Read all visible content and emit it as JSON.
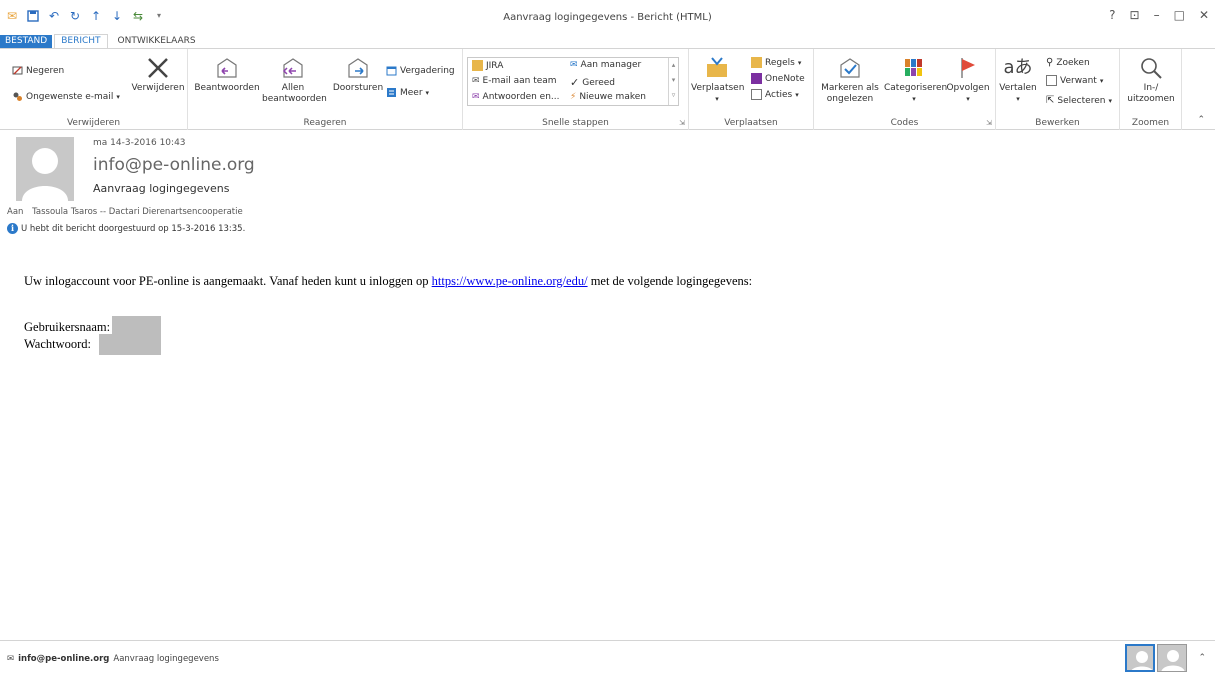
{
  "window": {
    "title": "Aanvraag logingegevens - Bericht (HTML)",
    "controls": {
      "help": "?",
      "restore": "⊡",
      "minimize": "–",
      "maximize": "□",
      "close": "✕"
    }
  },
  "qat_icons": [
    "mail-icon",
    "save-icon",
    "undo-icon",
    "redo-icon",
    "up-icon",
    "down-icon",
    "move-icon",
    "customize-icon"
  ],
  "tabs": [
    {
      "label": "BESTAND"
    },
    {
      "label": "BERICHT"
    },
    {
      "label": "ONTWIKKELAARS"
    }
  ],
  "ribbon": {
    "verwijderen": {
      "label": "Verwijderen",
      "negeren": "Negeren",
      "ongewenste": "Ongewenste e-mail",
      "verwijderen_btn": "Verwijderen"
    },
    "reageren": {
      "label": "Reageren",
      "beantwoorden": "Beantwoorden",
      "allen_1": "Allen",
      "allen_2": "beantwoorden",
      "doorsturen": "Doorsturen",
      "vergadering": "Vergadering",
      "meer": "Meer"
    },
    "snelle_stappen": {
      "label": "Snelle stappen",
      "items": [
        "JIRA",
        "Aan manager",
        "E-mail aan team",
        "Gereed",
        "Antwoorden en...",
        "Nieuwe maken"
      ]
    },
    "verplaatsen": {
      "label": "Verplaatsen",
      "verplaatsen_btn": "Verplaatsen",
      "regels": "Regels",
      "onenote": "OneNote",
      "acties": "Acties"
    },
    "codes": {
      "label": "Codes",
      "markeren_1": "Markeren als",
      "markeren_2": "ongelezen",
      "categoriseren": "Categoriseren",
      "opvolgen": "Opvolgen"
    },
    "bewerken": {
      "label": "Bewerken",
      "vertalen": "Vertalen",
      "zoeken": "Zoeken",
      "verwant": "Verwant",
      "selecteren": "Selecteren"
    },
    "zoomen": {
      "label": "Zoomen",
      "inuit_1": "In-/",
      "inuit_2": "uitzoomen"
    }
  },
  "message": {
    "date": "ma 14-3-2016 10:43",
    "from": "info@pe-online.org",
    "subject": "Aanvraag logingegevens",
    "to_label": "Aan",
    "to_value": "Tassoula Tsaros -- Dactari Dierenartsencooperatie",
    "info": "U hebt dit bericht doorgestuurd op 15-3-2016 13:35."
  },
  "body": {
    "line1_pre": "Uw inlogaccount voor PE-online is aangemaakt. Vanaf heden kunt u inloggen op ",
    "link": "https://www.pe-online.org/edu/",
    "line1_post": " met de volgende logingegevens:",
    "username_label": "Gebruikersnaam:",
    "password_label": "Wachtwoord:"
  },
  "footer": {
    "sender": "info@pe-online.org",
    "subject": "Aanvraag logingegevens"
  },
  "colors": {
    "accent": "#2b79c9",
    "link": "#0000ee",
    "redaction": "#bdbdbd"
  }
}
